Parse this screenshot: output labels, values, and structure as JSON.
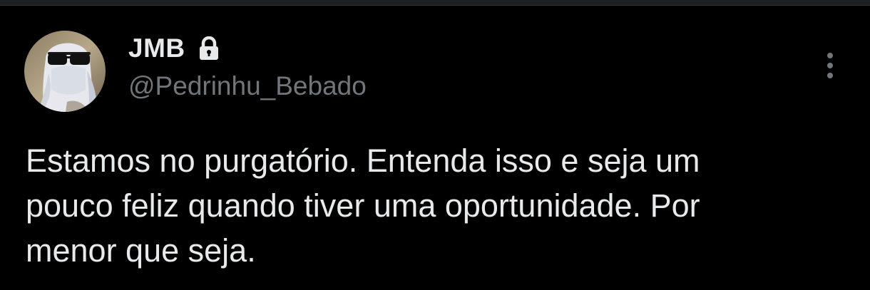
{
  "tweet": {
    "author": {
      "display_name": "JMB",
      "handle": "@Pedrinhu_Bebado",
      "protected_icon": "lock-icon",
      "avatar_icon": "avatar"
    },
    "more_icon": "more-vertical-icon",
    "text": "Estamos no purgatório. Entenda isso e seja um\npouco feliz quando tiver uma oportunidade. Por\nmenor que seja."
  },
  "colors": {
    "background": "#000000",
    "primary_text": "#e7e9ea",
    "secondary_text": "#71767b",
    "divider": "#1c1f23"
  }
}
